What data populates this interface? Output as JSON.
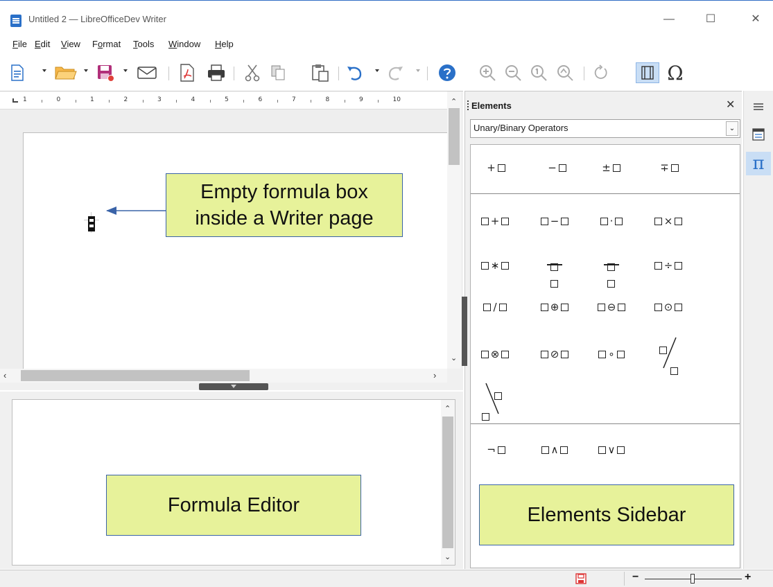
{
  "window": {
    "title": "Untitled 2 — LibreOfficeDev Writer",
    "minimize_glyph": "—",
    "maximize_glyph": "☐",
    "close_glyph": "✕"
  },
  "menu": [
    {
      "pre": "",
      "key": "F",
      "post": "ile"
    },
    {
      "pre": "",
      "key": "E",
      "post": "dit"
    },
    {
      "pre": "",
      "key": "V",
      "post": "iew"
    },
    {
      "pre": "F",
      "key": "o",
      "post": "rmat"
    },
    {
      "pre": "",
      "key": "T",
      "post": "ools"
    },
    {
      "pre": "",
      "key": "W",
      "post": "indow"
    },
    {
      "pre": "",
      "key": "H",
      "post": "elp"
    }
  ],
  "toolbar_icons": [
    "new-document-icon",
    "open-folder-icon",
    "save-icon",
    "email-icon",
    "export-pdf-icon",
    "print-icon",
    "cut-icon",
    "copy-icon",
    "paste-icon",
    "undo-icon",
    "redo-icon",
    "help-icon",
    "zoom-in-icon",
    "zoom-out-icon",
    "zoom-100-icon",
    "zoom-page-icon",
    "refresh-icon",
    "formula-cursor-icon",
    "special-character-icon"
  ],
  "ruler": {
    "labels": [
      "1",
      "0",
      "1",
      "2",
      "3",
      "4",
      "5",
      "6",
      "7",
      "8",
      "9",
      "10"
    ]
  },
  "callouts": {
    "formula_box": [
      "Empty formula box",
      "inside a Writer page"
    ],
    "formula_editor": "Formula Editor",
    "elements_sidebar": "Elements Sidebar"
  },
  "sidebar": {
    "title": "Elements",
    "close_glyph": "✕",
    "category": "Unary/Binary Operators"
  },
  "elements": {
    "unary": [
      "+",
      "−",
      "±",
      "∓"
    ],
    "binary_row1": [
      "+",
      "−",
      "·",
      "×"
    ],
    "binary_row2": [
      "∗",
      "frac",
      "frac",
      "÷"
    ],
    "binary_row3": [
      "/",
      "⊕",
      "⊖",
      "⊙"
    ],
    "binary_row4": [
      "⊗",
      "⊘",
      "∘",
      "wideslash"
    ],
    "binary_row5": [
      "widebslash"
    ],
    "logic": [
      "¬",
      "∧",
      "∨"
    ]
  },
  "colors": {
    "callout_fill": "#e7f29a",
    "callout_border": "#3a63a8",
    "arrow": "#3a63a8",
    "deck_active": "#c9def5"
  }
}
